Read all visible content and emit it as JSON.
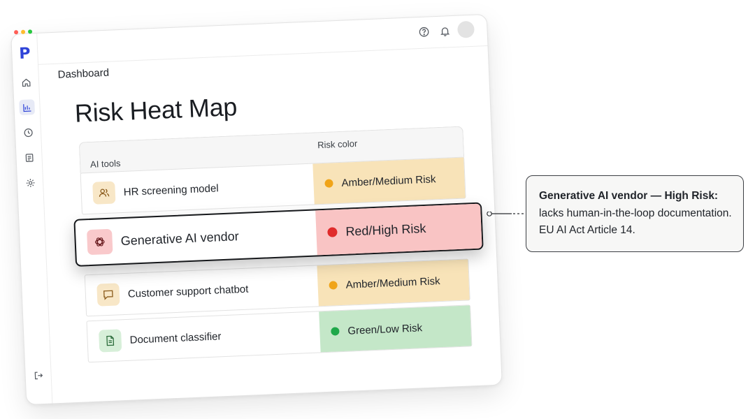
{
  "sidebar": {
    "logo_letter": "P",
    "items": [
      {
        "icon": "home-icon"
      },
      {
        "icon": "chart-icon",
        "active": true
      },
      {
        "icon": "clock-icon"
      },
      {
        "icon": "document-icon"
      },
      {
        "icon": "gear-icon"
      }
    ],
    "bottom_icon": "logout-icon"
  },
  "header": {
    "breadcrumb": "Dashboard",
    "icons": [
      "help-icon",
      "bell-icon"
    ],
    "avatar": "avatar"
  },
  "page": {
    "title": "Risk Heat Map"
  },
  "table": {
    "columns": [
      "AI tools",
      "Risk color"
    ],
    "rows": [
      {
        "tool": "HR screening model",
        "icon": "users-icon",
        "risk": "Amber/Medium Risk",
        "level": "medium"
      },
      {
        "tool": "Generative AI vendor",
        "icon": "openai-icon",
        "risk": "Red/High Risk",
        "level": "high",
        "highlighted": true
      },
      {
        "tool": "Customer support chatbot",
        "icon": "chat-icon",
        "risk": "Amber/Medium Risk",
        "level": "medium"
      },
      {
        "tool": "Document classifier",
        "icon": "file-icon",
        "risk": "Green/Low Risk",
        "level": "low"
      }
    ]
  },
  "callout": {
    "title": "Generative AI vendor — High Risk:",
    "body": "lacks human-in-the-loop documentation. EU AI Act Article 14."
  },
  "colors": {
    "brand": "#2f44d8",
    "medium_bg": "#f8e3b8",
    "medium_dot": "#f0a418",
    "high_bg": "#f9c4c4",
    "high_dot": "#e02b2b",
    "low_bg": "#c4e7c8",
    "low_dot": "#1fa84a",
    "window_dots": [
      "#ff5f57",
      "#febc2e",
      "#28c840"
    ]
  }
}
